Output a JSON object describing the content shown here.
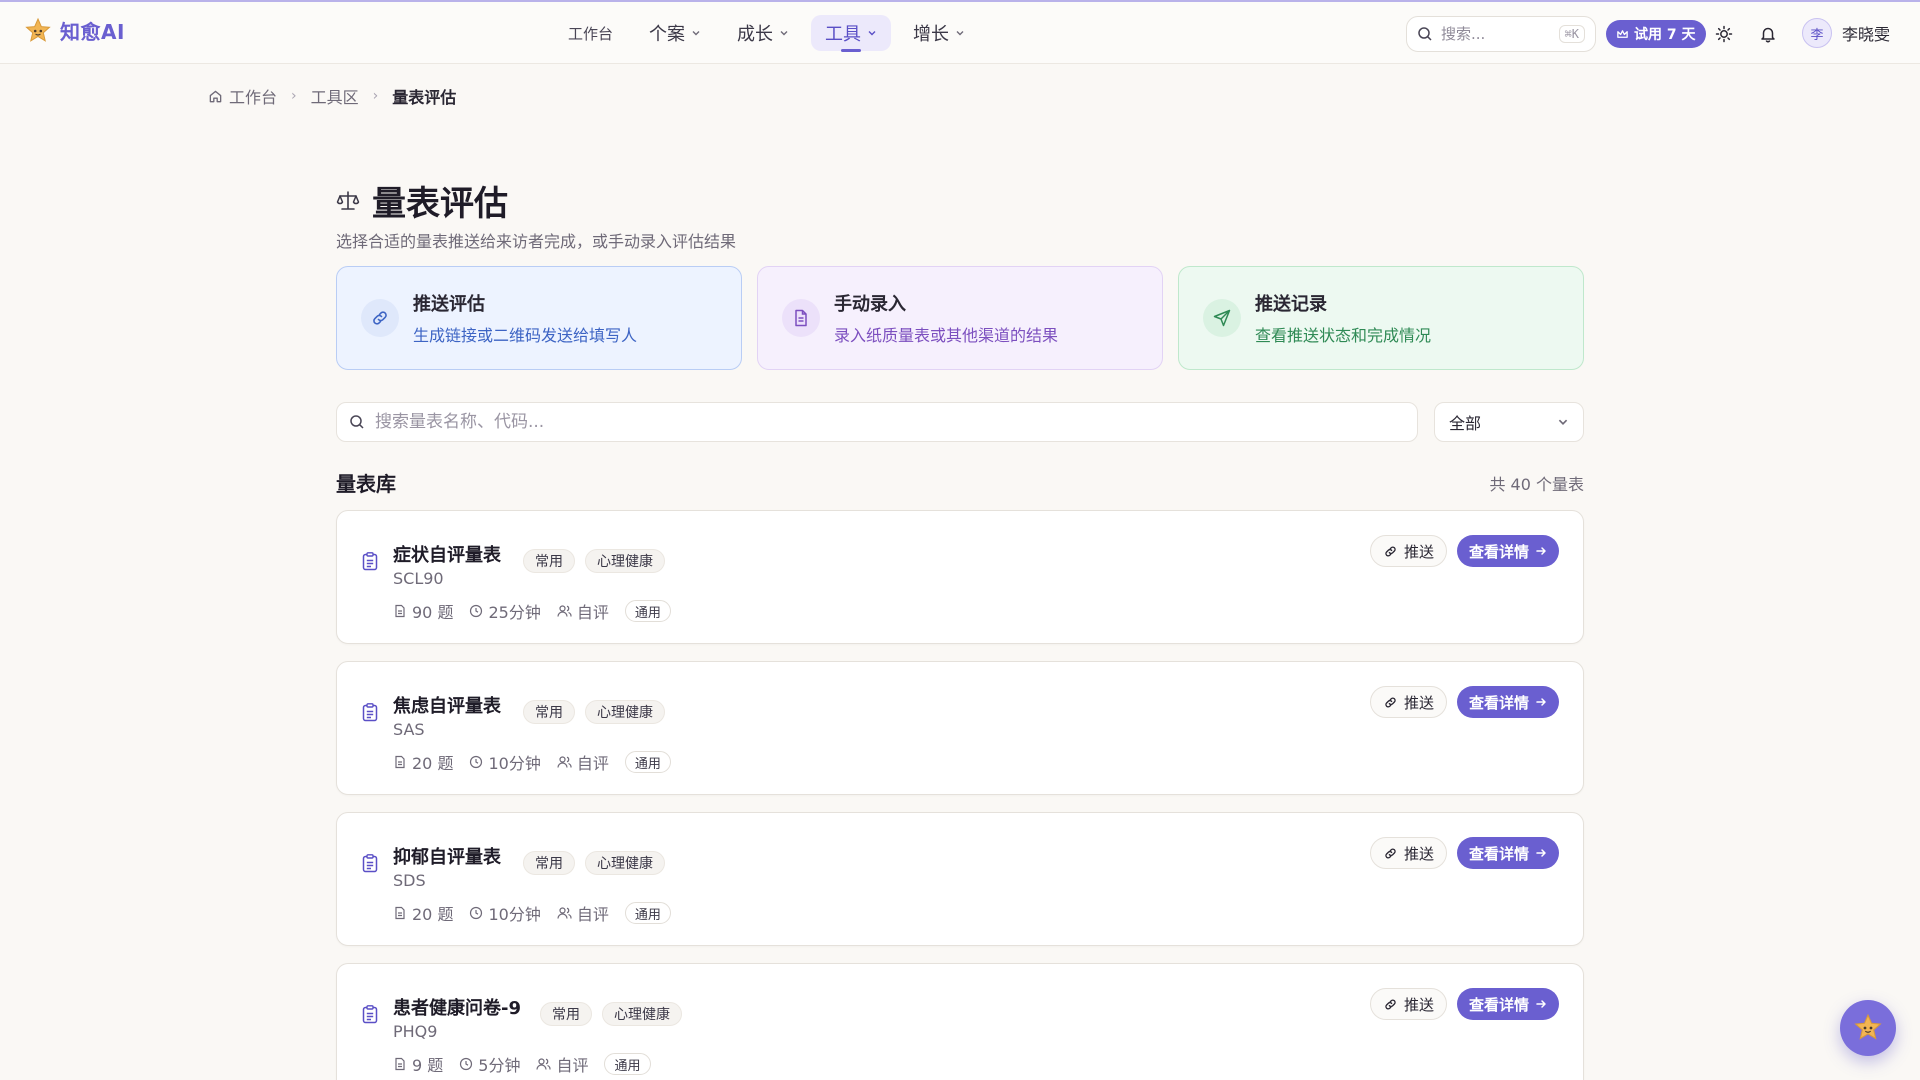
{
  "brand": {
    "name": "知愈AI"
  },
  "nav": {
    "workbench": "工作台",
    "cases": "个案",
    "growth": "成长",
    "tools": "工具",
    "increase": "增长"
  },
  "header": {
    "search_placeholder": "搜索...",
    "search_shortcut": "⌘K",
    "trial_label": "试用 7 天",
    "user_initial": "李",
    "user_name": "李晓雯"
  },
  "breadcrumb": {
    "home": "工作台",
    "section": "工具区",
    "current": "量表评估"
  },
  "page": {
    "title": "量表评估",
    "subtitle": "选择合适的量表推送给来访者完成，或手动录入评估结果"
  },
  "actions": [
    {
      "title": "推送评估",
      "desc": "生成链接或二维码发送给填写人"
    },
    {
      "title": "手动录入",
      "desc": "录入纸质量表或其他渠道的结果"
    },
    {
      "title": "推送记录",
      "desc": "查看推送状态和完成情况"
    }
  ],
  "filter": {
    "search_placeholder": "搜索量表名称、代码...",
    "select_value": "全部"
  },
  "library": {
    "title": "量表库",
    "count": "共 40 个量表"
  },
  "scales": [
    {
      "name": "症状自评量表",
      "code": "SCL90",
      "tag1": "常用",
      "tag2": "心理健康",
      "items": "90 题",
      "time": "25分钟",
      "mode": "自评",
      "scope": "通用",
      "push": "推送",
      "detail": "查看详情"
    },
    {
      "name": "焦虑自评量表",
      "code": "SAS",
      "tag1": "常用",
      "tag2": "心理健康",
      "items": "20 题",
      "time": "10分钟",
      "mode": "自评",
      "scope": "通用",
      "push": "推送",
      "detail": "查看详情"
    },
    {
      "name": "抑郁自评量表",
      "code": "SDS",
      "tag1": "常用",
      "tag2": "心理健康",
      "items": "20 题",
      "time": "10分钟",
      "mode": "自评",
      "scope": "通用",
      "push": "推送",
      "detail": "查看详情"
    },
    {
      "name": "患者健康问卷-9",
      "code": "PHQ9",
      "tag1": "常用",
      "tag2": "心理健康",
      "items": "9 题",
      "time": "5分钟",
      "mode": "自评",
      "scope": "通用",
      "push": "推送",
      "detail": "查看详情"
    }
  ],
  "colors": {
    "accent": "#6a5fd0",
    "blue": "#3d64c4",
    "purple": "#7c4fbf",
    "green": "#2f8a55"
  },
  "icons": {
    "brand": "star-mascot-icon",
    "search": "search-icon",
    "theme": "sun-icon",
    "notifications": "bell-icon",
    "home": "home-icon",
    "page": "scale-balance-icon",
    "push_eval": "link-icon",
    "manual_entry": "file-text-icon",
    "push_records": "send-icon",
    "scale": "clipboard-list-icon",
    "items": "file-icon",
    "time": "clock-icon",
    "mode": "users-icon",
    "detail_arrow": "arrow-right-icon",
    "fab": "star-mascot-icon"
  }
}
